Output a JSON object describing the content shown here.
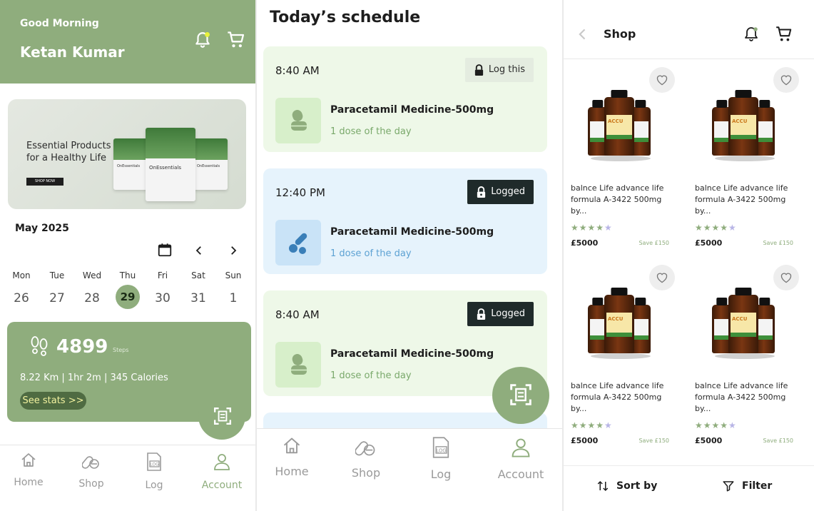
{
  "home": {
    "greeting": "Good Morning",
    "user_name": "Ketan Kumar",
    "banner": {
      "line1": "Essential Products",
      "line2": "for a Healthy Life",
      "button": "SHOP NOW",
      "brand": "OnEssentials"
    },
    "calendar": {
      "month": "May 2025",
      "days": [
        {
          "dow": "Mon",
          "date": "26"
        },
        {
          "dow": "Tue",
          "date": "27"
        },
        {
          "dow": "Wed",
          "date": "28"
        },
        {
          "dow": "Thu",
          "date": "29",
          "selected": true
        },
        {
          "dow": "Fri",
          "date": "30"
        },
        {
          "dow": "Sat",
          "date": "31"
        },
        {
          "dow": "Sun",
          "date": "1"
        }
      ]
    },
    "steps": {
      "count": "4899",
      "unit": "Steps",
      "summary": "8.22 Km | 1hr 2m | 345 Calories",
      "button": "See stats >>"
    }
  },
  "schedule": {
    "title": "Today’s schedule",
    "items": [
      {
        "time": "8:40 AM",
        "action": "Log this",
        "medicine": "Paracetamil Medicine-500mg",
        "dose": "1 dose of the day"
      },
      {
        "time": "12:40 PM",
        "action": "Logged",
        "medicine": "Paracetamil Medicine-500mg",
        "dose": "1 dose of the day"
      },
      {
        "time": "8:40 AM",
        "action": "Logged",
        "medicine": "Paracetamil Medicine-500mg",
        "dose": "1 dose of the day"
      }
    ]
  },
  "nav": {
    "home": "Home",
    "shop": "Shop",
    "log": "Log",
    "account": "Account"
  },
  "shop": {
    "title": "Shop",
    "products": [
      {
        "name": "balnce Life advance life formula A-3422 500mg by...",
        "price": "£5000",
        "save": "Save £150",
        "rating": 4,
        "jar_label": "ACCU"
      },
      {
        "name": "balnce Life advance life formula A-3422 500mg by...",
        "price": "£5000",
        "save": "Save £150",
        "rating": 4,
        "jar_label": "ACCU"
      },
      {
        "name": "balnce Life advance life formula A-3422 500mg by...",
        "price": "£5000",
        "save": "Save £150",
        "rating": 4,
        "jar_label": "ACCU"
      },
      {
        "name": "balnce Life advance life formula A-3422 500mg by...",
        "price": "£5000",
        "save": "Save £150",
        "rating": 4,
        "jar_label": "ACCU"
      }
    ],
    "sort_label": "Sort by",
    "filter_label": "Filter"
  },
  "colors": {
    "accent": "#8fad7d",
    "dark_button": "#1f2a2a",
    "green_card": "#eef8e8",
    "blue_card": "#e6f3fc",
    "star_off": "#b8b5e6"
  }
}
